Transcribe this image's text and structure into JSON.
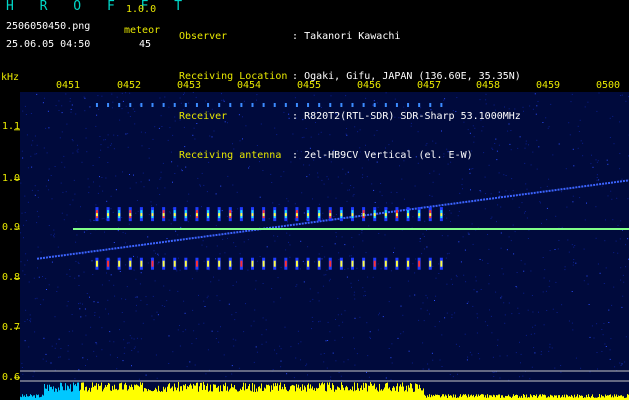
{
  "app": {
    "title": "H R O F F T",
    "version": "1.0.0",
    "filename": "2506050450.png",
    "datetime": "25.06.05 04:50",
    "meteor_label": "meteor",
    "meteor_count": "45"
  },
  "station": {
    "observer_label": "Observer",
    "observer_value": "Takanori Kawachi",
    "location_label": "Receiving Location",
    "location_value": "Ogaki, Gifu, JAPAN (136.60E, 35.35N)",
    "receiver_label": "Receiver",
    "receiver_value": "R820T2(RTL-SDR) SDR-Sharp 53.1000MHz",
    "antenna_label": "Receiving antenna",
    "antenna_value": "2el-HB9CV Vertical (el. E-W)",
    "separator": ":"
  },
  "colors": {
    "background": "#000000",
    "noise_floor": "#000a3c",
    "axis_text": "#e8e800",
    "title_text": "#00d7c8",
    "carrier_line": "#00ff88",
    "bottom_meter": "#ffff00",
    "bottom_meter_alt": "#00c8ff"
  },
  "chart_data": {
    "type": "heatmap",
    "y_unit": "kHz",
    "y_ticks": [
      "1.1",
      "1.0",
      "0.9",
      "0.8",
      "0.7",
      "0.6"
    ],
    "y_tick_values": [
      1.1,
      1.0,
      0.9,
      0.8,
      0.7,
      0.6
    ],
    "ylim": [
      0.6,
      1.2
    ],
    "x_ticks": [
      "0451",
      "0452",
      "0453",
      "0454",
      "0455",
      "0456",
      "0457",
      "0458",
      "0459",
      "0500"
    ],
    "x_tick_minutes": [
      1,
      2,
      3,
      4,
      5,
      6,
      7,
      8,
      9,
      10
    ],
    "xlim_minutes": [
      0.5,
      10.5
    ],
    "carrier_khz": 0.9,
    "carrier_start_minute": 1.1,
    "drift_line": {
      "start": {
        "minute": 0.5,
        "khz": 0.84
      },
      "end": {
        "minute": 10.5,
        "khz": 1.0
      }
    },
    "meteor_pings": {
      "upper_khz": 0.93,
      "lower_khz": 0.83,
      "top_row_khz": 1.15,
      "start_minute": 1.5,
      "end_minute": 7.25,
      "count": 32
    },
    "grid": false
  }
}
